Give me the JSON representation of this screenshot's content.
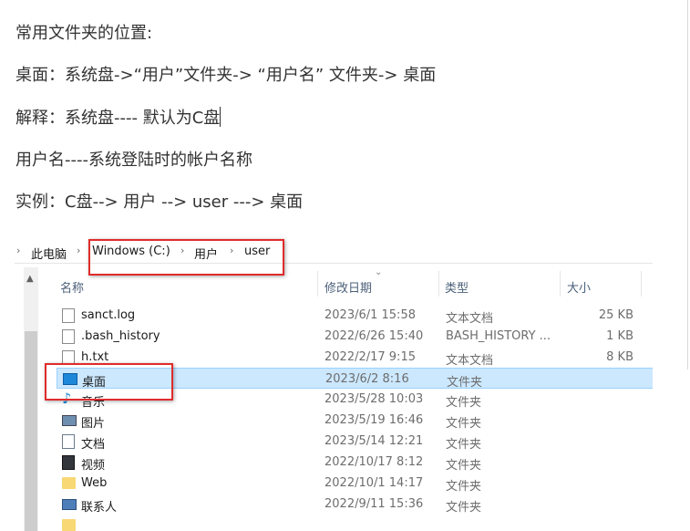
{
  "document": {
    "lines": [
      "常用文件夹的位置:",
      "桌面：系统盘->“用户”文件夹-> “用户名” 文件夹->  桌面",
      "解释：系统盘---- 默认为C盘",
      "用户名----系统登陆时的帐户名称",
      "实例：C盘--> 用户 --> user ---> 桌面"
    ]
  },
  "explorer": {
    "breadcrumb": {
      "this_pc": "此电脑",
      "drive": "Windows (C:)",
      "users": "用户",
      "user": "user"
    },
    "columns": {
      "name": "名称",
      "modified": "修改日期",
      "type": "类型",
      "size": "大小"
    },
    "rows": [
      {
        "name": "sanct.log",
        "modified": "2023/6/1 15:58",
        "type": "文本文档",
        "size": "25 KB",
        "icon": "file-icon"
      },
      {
        "name": ".bash_history",
        "modified": "2022/6/26 15:40",
        "type": "BASH_HISTORY ...",
        "size": "1 KB",
        "icon": "file-icon"
      },
      {
        "name": "h.txt",
        "modified": "2022/2/17 9:15",
        "type": "文本文档",
        "size": "8 KB",
        "icon": "file-icon"
      },
      {
        "name": "桌面",
        "modified": "2023/6/2 8:16",
        "type": "文件夹",
        "size": "",
        "icon": "desktop-icon"
      },
      {
        "name": "音乐",
        "modified": "2023/5/28 10:03",
        "type": "文件夹",
        "size": "",
        "icon": "music-icon"
      },
      {
        "name": "图片",
        "modified": "2023/5/19 16:46",
        "type": "文件夹",
        "size": "",
        "icon": "pictures-icon"
      },
      {
        "name": "文档",
        "modified": "2023/5/14 12:21",
        "type": "文件夹",
        "size": "",
        "icon": "documents-icon"
      },
      {
        "name": "视频",
        "modified": "2022/10/17 8:12",
        "type": "文件夹",
        "size": "",
        "icon": "video-icon"
      },
      {
        "name": "Web",
        "modified": "2022/10/1 14:17",
        "type": "文件夹",
        "size": "",
        "icon": "folder-icon"
      },
      {
        "name": "联系人",
        "modified": "2022/9/11 15:36",
        "type": "文件夹",
        "size": "",
        "icon": "contacts-icon"
      }
    ],
    "selected_row": "桌面",
    "colors": {
      "highlight": "#e02b2b",
      "selection": "#cce8ff"
    }
  }
}
